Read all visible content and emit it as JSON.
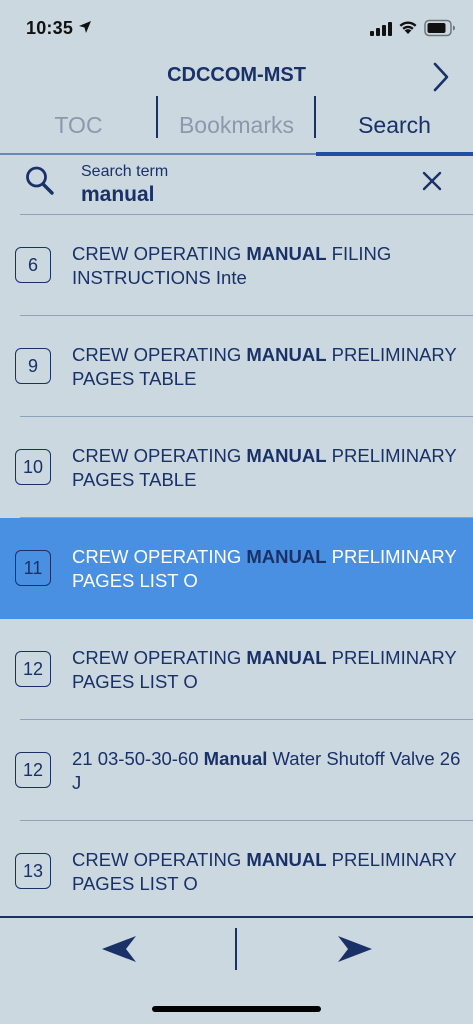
{
  "status": {
    "time": "10:35"
  },
  "nav": {
    "title": "CDCCOM-MST"
  },
  "tabs": [
    {
      "label": "TOC"
    },
    {
      "label": "Bookmarks"
    },
    {
      "label": "Search"
    }
  ],
  "search": {
    "label": "Search term",
    "value": "manual"
  },
  "results": [
    {
      "page": "6",
      "pre": "CREW OPERATING ",
      "match": "MANUAL",
      "post": " FILING INSTRUCTIONS Inte"
    },
    {
      "page": "9",
      "pre": "CREW OPERATING ",
      "match": "MANUAL",
      "post": " PRELIMINARY PAGES TABLE"
    },
    {
      "page": "10",
      "pre": "CREW OPERATING ",
      "match": "MANUAL",
      "post": " PRELIMINARY PAGES TABLE"
    },
    {
      "page": "11",
      "pre": "CREW OPERATING ",
      "match": "MANUAL",
      "post": " PRELIMINARY PAGES LIST O",
      "selected": true
    },
    {
      "page": "12",
      "pre": "CREW OPERATING ",
      "match": "MANUAL",
      "post": " PRELIMINARY PAGES LIST O"
    },
    {
      "page": "12",
      "pre": "21 03-50-30-60 ",
      "match": "Manual",
      "post": " Water Shutoff Valve 26 J"
    },
    {
      "page": "13",
      "pre": "CREW OPERATING ",
      "match": "MANUAL",
      "post": " PRELIMINARY PAGES LIST O"
    }
  ],
  "colors": {
    "background": "#cbd8e0",
    "primary": "#1a3168",
    "selected_row": "#4a90e2",
    "inactive_tab": "#8b99ad"
  },
  "icons": {
    "location": "location-arrow-icon",
    "signal": "cellular-signal-icon",
    "wifi": "wifi-icon",
    "battery": "battery-icon",
    "forward": "chevron-right-icon",
    "search": "search-icon",
    "clear": "close-icon",
    "prev": "arrow-left-icon",
    "next": "arrow-right-icon"
  }
}
